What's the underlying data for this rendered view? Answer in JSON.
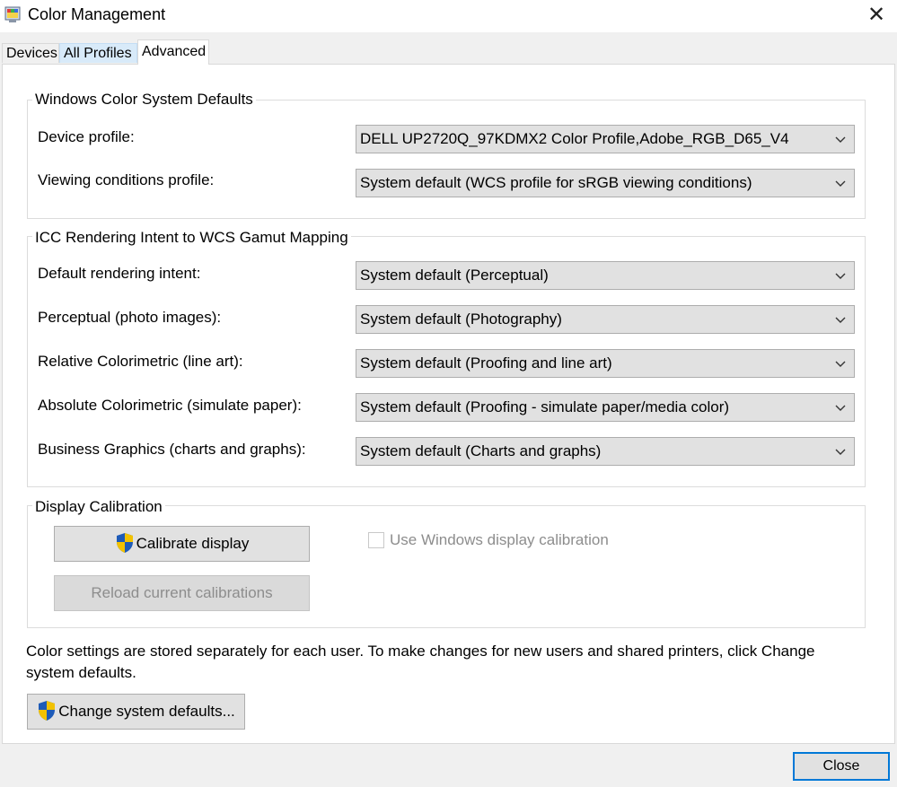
{
  "window": {
    "title": "Color Management"
  },
  "tabs": [
    {
      "label": "Devices"
    },
    {
      "label": "All Profiles"
    },
    {
      "label": "Advanced"
    }
  ],
  "wcs_defaults": {
    "title": "Windows Color System Defaults",
    "device_profile_label": "Device profile:",
    "device_profile_value": "DELL UP2720Q_97KDMX2 Color Profile,Adobe_RGB_D65_V4",
    "viewing_label": "Viewing conditions profile:",
    "viewing_value": "System default (WCS profile for sRGB viewing conditions)"
  },
  "icc_mapping": {
    "title": "ICC Rendering Intent to WCS Gamut Mapping",
    "rows": [
      {
        "label": "Default rendering intent:",
        "value": "System default (Perceptual)"
      },
      {
        "label": "Perceptual (photo images):",
        "value": "System default (Photography)"
      },
      {
        "label": "Relative Colorimetric (line art):",
        "value": "System default (Proofing and line art)"
      },
      {
        "label": "Absolute Colorimetric (simulate paper):",
        "value": "System default (Proofing - simulate paper/media color)"
      },
      {
        "label": "Business Graphics (charts and graphs):",
        "value": "System default (Charts and graphs)"
      }
    ]
  },
  "calibration": {
    "title": "Display Calibration",
    "calibrate_button": "Calibrate display",
    "reload_button": "Reload current calibrations",
    "use_windows_label": "Use Windows display calibration",
    "use_windows_checked": false
  },
  "footer": {
    "note": "Color settings are stored separately for each user. To make changes for new users and shared printers, click Change system defaults.",
    "change_defaults_button": "Change system defaults...",
    "close_button": "Close"
  },
  "colors": {
    "accent": "#0078d7",
    "shield_blue": "#1e5bb8",
    "shield_yellow": "#f2c200"
  }
}
